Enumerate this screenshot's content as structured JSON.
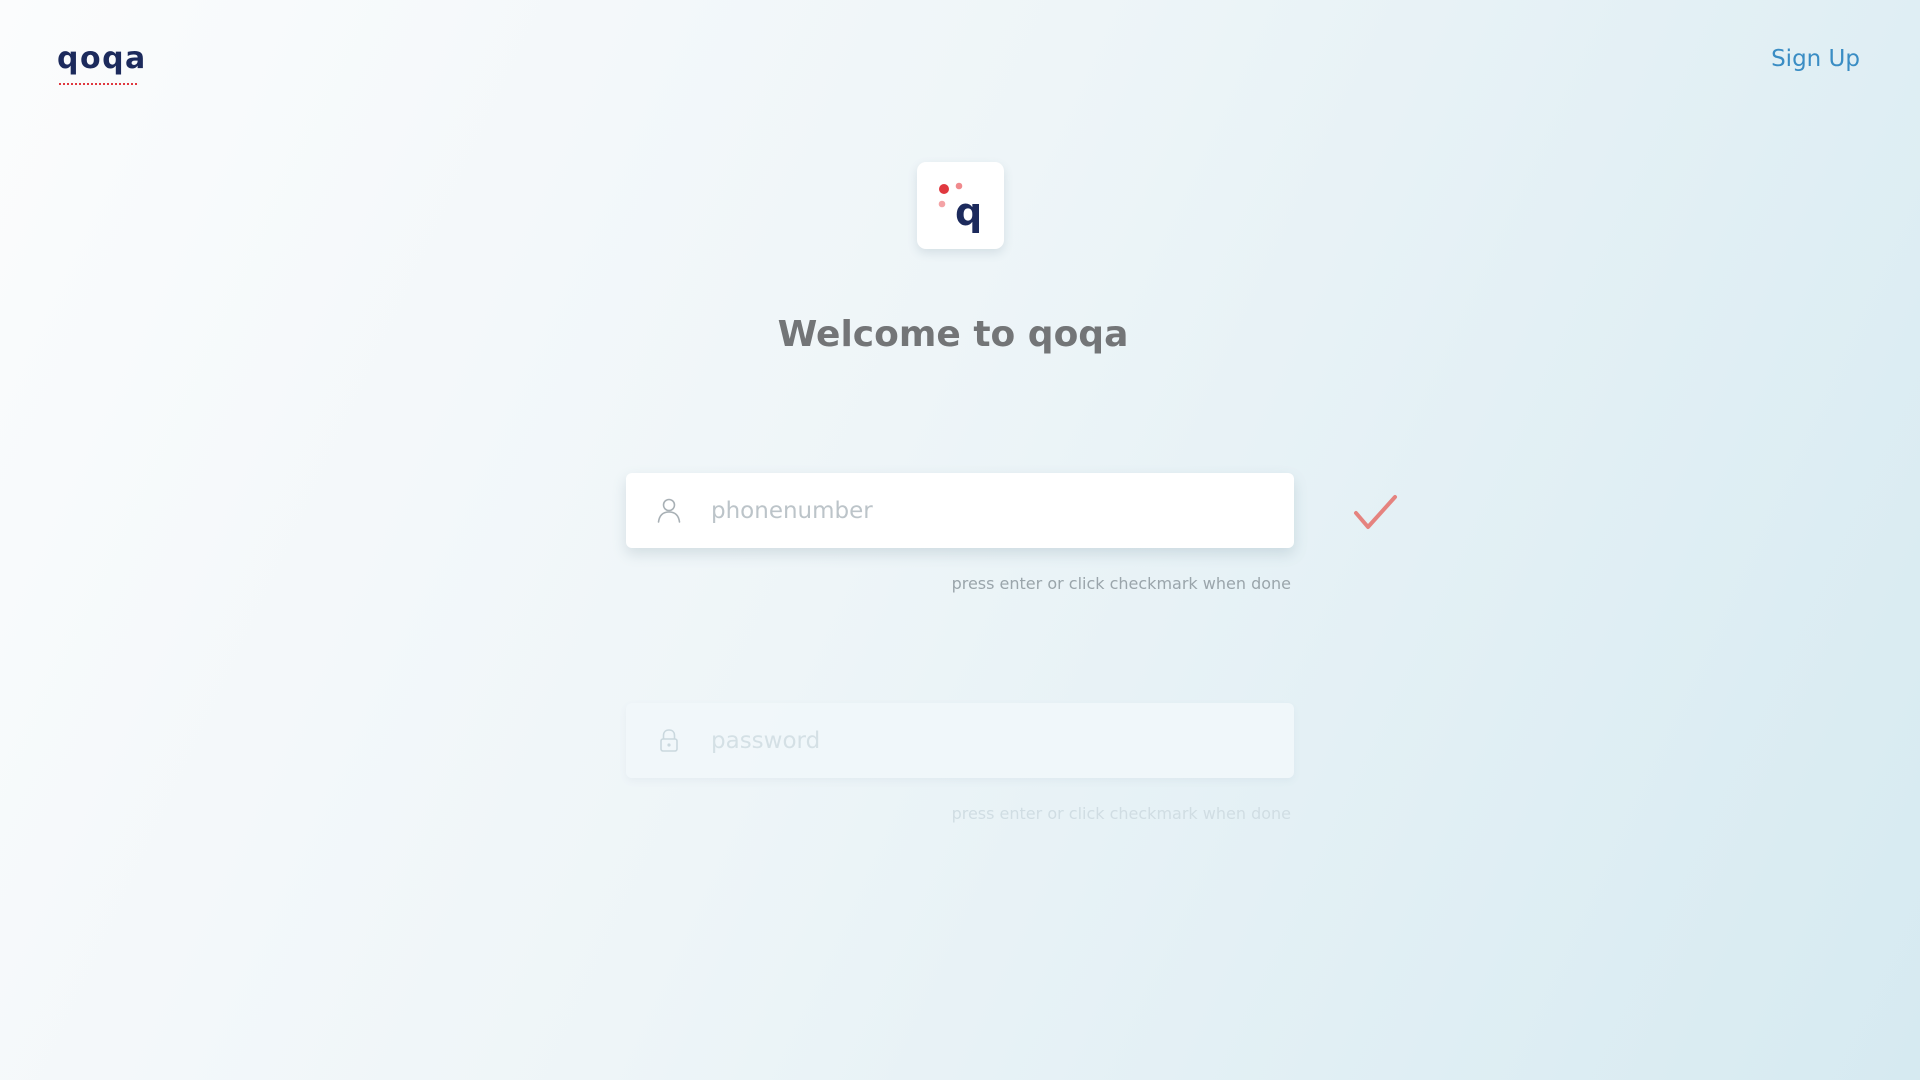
{
  "header": {
    "brand": "qoqa",
    "signup_label": "Sign Up"
  },
  "logo": {
    "letter": "q",
    "icon": "qoqa-logo-icon",
    "dot_color": "#e0383f",
    "letter_color": "#1c2a5c"
  },
  "main": {
    "welcome": "Welcome to qoqa"
  },
  "phone_field": {
    "placeholder": "phonenumber",
    "value": "",
    "icon": "user-icon",
    "hint": "press enter or click checkmark when done"
  },
  "password_field": {
    "placeholder": "password",
    "value": "",
    "icon": "lock-icon",
    "hint": "press enter or click checkmark when done"
  },
  "submit": {
    "icon": "checkmark-icon",
    "color": "#e5837f"
  },
  "colors": {
    "brand": "#1c2a5c",
    "accent_red": "#e0383f",
    "link_blue": "#3a8dc4",
    "heading_gray": "#737577"
  }
}
